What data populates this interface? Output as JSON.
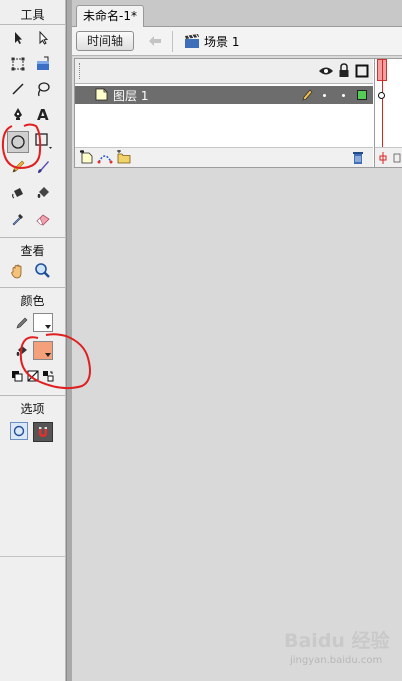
{
  "toolbox": {
    "sections": {
      "tools": "工具",
      "view": "查看",
      "colors": "颜色",
      "options": "选项"
    },
    "colors": {
      "stroke_swatch": "#ffffff",
      "fill_swatch": "#f4a07a"
    }
  },
  "document": {
    "tab_title": "未命名-1*",
    "timeline_button": "时间轴",
    "scene_label": "场景 1"
  },
  "timeline": {
    "layers": [
      {
        "name": "图层 1",
        "color": "#55cc55"
      }
    ]
  },
  "watermark": {
    "brand": "Baidu 经验",
    "site": "jingyan.baidu.com"
  },
  "annotation": {
    "stroke_color": "#e02020"
  }
}
